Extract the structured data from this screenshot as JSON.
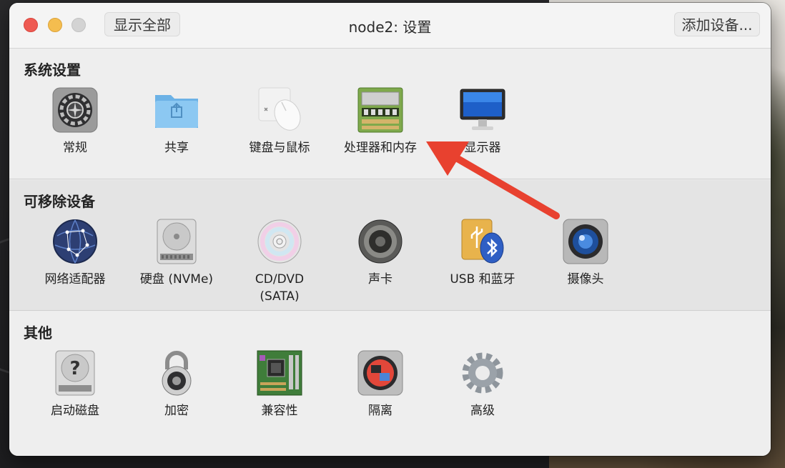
{
  "window": {
    "title": "node2: 设置",
    "show_all_label": "显示全部",
    "add_device_label": "添加设备..."
  },
  "sections": [
    {
      "title": "系统设置",
      "items": [
        {
          "label": "常规",
          "icon": "gear-panel-icon"
        },
        {
          "label": "共享",
          "icon": "shared-folder-icon"
        },
        {
          "label": "键盘与鼠标",
          "icon": "keyboard-mouse-icon"
        },
        {
          "label": "处理器和内存",
          "icon": "memory-chip-icon"
        },
        {
          "label": "显示器",
          "icon": "monitor-icon"
        }
      ]
    },
    {
      "title": "可移除设备",
      "items": [
        {
          "label": "网络适配器",
          "icon": "network-globe-icon"
        },
        {
          "label": "硬盘 (NVMe)",
          "icon": "hard-disk-icon"
        },
        {
          "label": "CD/DVD\n(SATA)",
          "icon": "cd-dvd-icon"
        },
        {
          "label": "声卡",
          "icon": "speaker-icon"
        },
        {
          "label": "USB 和蓝牙",
          "icon": "usb-bluetooth-icon"
        },
        {
          "label": "摄像头",
          "icon": "camera-icon"
        }
      ]
    },
    {
      "title": "其他",
      "items": [
        {
          "label": "启动磁盘",
          "icon": "startup-disk-icon"
        },
        {
          "label": "加密",
          "icon": "padlock-icon"
        },
        {
          "label": "兼容性",
          "icon": "motherboard-icon"
        },
        {
          "label": "隔离",
          "icon": "isolation-icon"
        },
        {
          "label": "高级",
          "icon": "advanced-gear-icon"
        }
      ]
    }
  ],
  "colors": {
    "arrow": "#e8412f",
    "close": "#ee5a52",
    "minimize": "#f4bd4f"
  }
}
